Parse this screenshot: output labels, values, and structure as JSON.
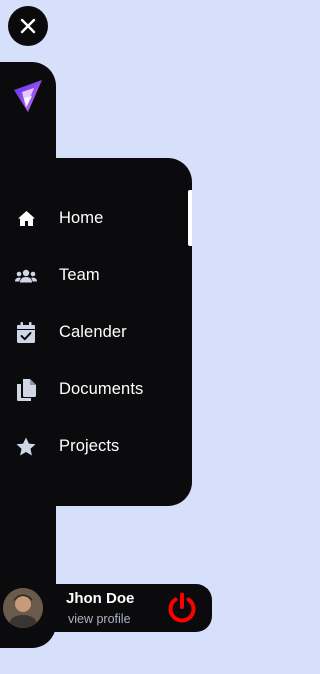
{
  "colors": {
    "background": "#d6e0fb",
    "sidebar": "#0b0b0d",
    "text": "#ffffff",
    "icon": "#cfd6e6",
    "muted_text": "#aeb3c2",
    "logout": "#ff0000",
    "logo_gradient": [
      "#7b2ff7",
      "#c471f5"
    ]
  },
  "nav": {
    "items": [
      {
        "label": "Home",
        "icon": "home-icon",
        "active": true
      },
      {
        "label": "Team",
        "icon": "users-icon",
        "active": false
      },
      {
        "label": "Calender",
        "icon": "calendar-check-icon",
        "active": false
      },
      {
        "label": "Documents",
        "icon": "documents-icon",
        "active": false
      },
      {
        "label": "Projects",
        "icon": "star-icon",
        "active": false
      }
    ]
  },
  "profile": {
    "name": "Jhon Doe",
    "link": "view profile"
  }
}
